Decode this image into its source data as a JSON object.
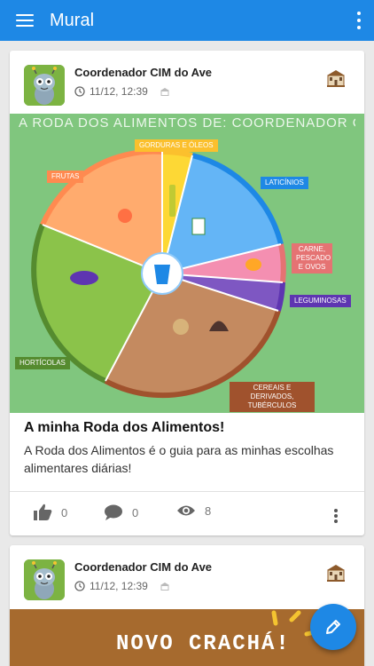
{
  "appbar": {
    "title": "Mural",
    "color": "#1e88e5"
  },
  "posts": [
    {
      "author": "Coordenador CIM do Ave",
      "date": "11/12, 12:39",
      "image_title": "A RODA DOS ALIMENTOS DE: COORDENADOR CIM DO AVE",
      "wheel_labels": {
        "gorduras": "GORDURAS E ÓLEOS",
        "laticinios": "LATICÍNIOS",
        "carne": "CARNE, PESCADO E OVOS",
        "leguminosas": "LEGUMINOSAS",
        "cereais": "CEREAIS E DERIVADOS, TUBÉRCULOS",
        "horticolas": "HORTÍCOLAS",
        "frutas": "FRUTAS"
      },
      "title": "A minha Roda dos Alimentos!",
      "text": "A Roda dos Alimentos é o guia para as minhas escolhas alimentares diárias!",
      "likes": "0",
      "comments": "0",
      "views": "8"
    },
    {
      "author": "Coordenador CIM do Ave",
      "date": "11/12, 12:39",
      "image_title": "NOVO CRACHÁ!"
    }
  ],
  "icons": {
    "menu": "menu-icon",
    "more": "more-vert-icon",
    "clock": "clock-icon",
    "visibility": "school-visibility-icon",
    "school": "school-building-icon",
    "like": "thumb-up-icon",
    "comment": "comment-icon",
    "views": "eye-icon",
    "fab": "pencil-icon"
  }
}
